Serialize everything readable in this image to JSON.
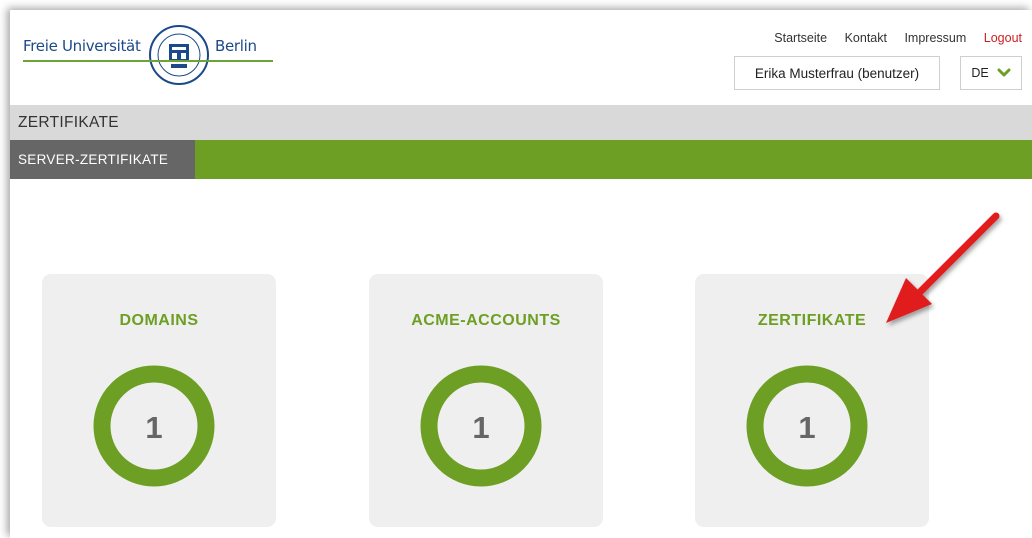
{
  "header": {
    "logo_left": "Freie Universität",
    "logo_right": "Berlin",
    "links": [
      "Startseite",
      "Kontakt",
      "Impressum"
    ],
    "logout": "Logout",
    "user": "Erika Musterfrau (benutzer)",
    "language": "DE"
  },
  "title_bar": {
    "title": "ZERTIFIKATE"
  },
  "nav": {
    "active_tab": "SERVER-ZERTIFIKATE"
  },
  "cards": [
    {
      "title": "DOMAINS",
      "count": "1"
    },
    {
      "title": "ACME-ACCOUNTS",
      "count": "1"
    },
    {
      "title": "ZERTIFIKATE",
      "count": "1"
    }
  ],
  "colors": {
    "accent_green": "#6c9f23",
    "link_red": "#cc1f1f",
    "annotation_arrow": "#e01b1b"
  }
}
